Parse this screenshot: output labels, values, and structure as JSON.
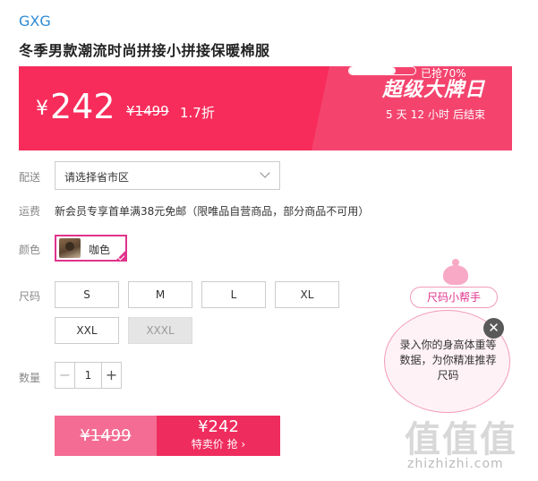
{
  "brand": "GXG",
  "product_title": "冬季男款潮流时尚拼接小拼接保暖棉服",
  "banner": {
    "currency": "¥",
    "price": "242",
    "original_price": "¥1499",
    "discount": "1.7折",
    "event_name": "超级大牌日",
    "countdown": {
      "days": "5",
      "days_unit": "天",
      "hours": "12",
      "hours_unit": "小时",
      "suffix": "后结束"
    },
    "sold_label": "已抢70%",
    "sold_fraction": 0.7
  },
  "delivery": {
    "label": "配送",
    "placeholder": "请选择省市区"
  },
  "shipping": {
    "label": "运费",
    "text": "新会员专享首单满38元免邮（限唯品自营商品，部分商品不可用）"
  },
  "color": {
    "label": "颜色",
    "option": "咖色"
  },
  "size": {
    "label": "尺码",
    "options": [
      "S",
      "M",
      "L",
      "XL",
      "XXL",
      "XXXL"
    ]
  },
  "quantity": {
    "label": "数量",
    "value": "1",
    "minus": "−",
    "plus": "+"
  },
  "buy": {
    "original_price": "¥1499",
    "price": "¥242",
    "action_label": "特卖价 抢 ›"
  },
  "size_helper": {
    "tag": "尺码小帮手",
    "text": "录入你的身高体重等数据，为你精准推荐尺码",
    "close": "✕"
  },
  "watermark": {
    "logo": "值值值",
    "url": "zhizhizhi.com"
  },
  "colors": {
    "accent": "#f72c5b",
    "brand_blue": "#2e8bd6",
    "pink": "#e0338c"
  }
}
